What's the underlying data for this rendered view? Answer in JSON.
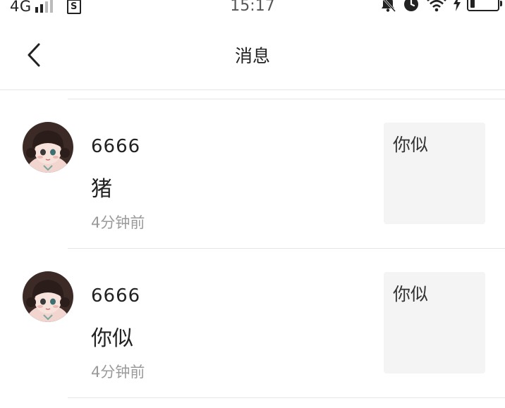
{
  "status_bar": {
    "network": "4G",
    "sim_icon_label": "S",
    "time": "15:17",
    "icons": [
      "signal-bars-icon",
      "sim-card-icon",
      "bell-muted-icon",
      "alarm-clock-icon",
      "wifi-icon",
      "charging-bolt-icon",
      "battery-icon"
    ],
    "battery_level": 0.15
  },
  "header": {
    "title": "消息",
    "back_icon": "chevron-left-icon"
  },
  "notifications": [
    {
      "user": "6666",
      "message": "猪",
      "time": "4分钟前",
      "quote": "你似"
    },
    {
      "user": "6666",
      "message": "你似",
      "time": "4分钟前",
      "quote": "你似"
    }
  ],
  "colors": {
    "text_primary": "#222222",
    "text_secondary": "#9a9a9a",
    "quote_background": "#f4f4f4",
    "divider": "#e6e6e6"
  }
}
